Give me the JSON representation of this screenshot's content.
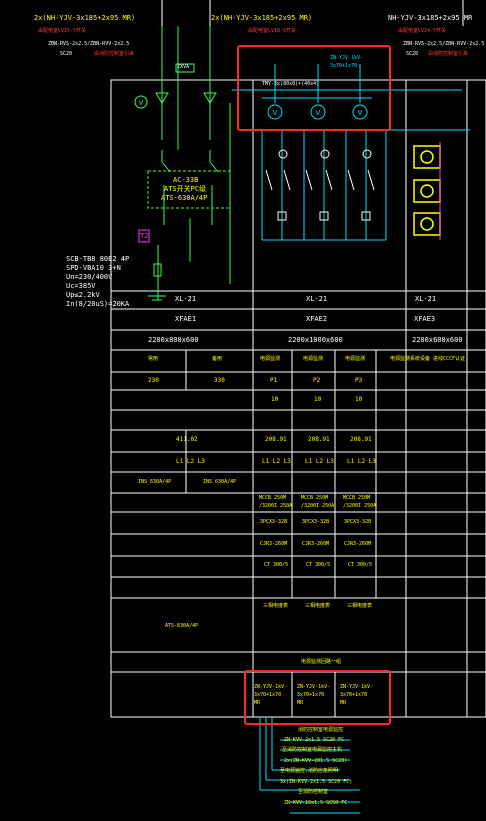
{
  "top_feeders": {
    "left_cable": "2x(NH-YJV-3x185+2x95  MR)",
    "left_source": "由配电室LVI5-5开关",
    "left_spd_cable": "ZBN-RVS-2x2.5/ZBN-RVV-2x2.5",
    "left_sc": "SC20",
    "left_fire_note": "由消防控制室引来",
    "mid_cable": "2x(NH-YJV-3x185+2x95  MR)",
    "mid_source": "由配电室LVI8-5开关",
    "right_cable": "NH-YJV-3x185+2x95  MR",
    "right_source": "由配电室LVI4-5开关",
    "right_spd_cable": "ZBN-RVS-2x2.5/ZBN-RVV-2x2.5",
    "right_sc": "SC20",
    "right_fire_note": "由消防控制室引来",
    "zxva": "ZXVA"
  },
  "measure_box": {
    "cable": "ZN-YJV-1kV-",
    "cable2": "3x70+1x70",
    "busbar": "TMY-3x(80x8)+(40x4)"
  },
  "ats": {
    "line1": "AC-33B",
    "line2": "ATS开关PC级",
    "line3": "ATS-630A/4P"
  },
  "t2_label": "T2",
  "spd_spec": [
    "SCB-TB8 80E2 4P",
    "SPD-VBA10 3+N",
    "Un=230/400V",
    "Uc=385V",
    "Up≤2.2kV",
    "In(8/20uS)=20KA"
  ],
  "header_rows": {
    "panel_numbers": [
      "XL-21",
      "XL-21",
      "XL-21"
    ],
    "panel_codes": [
      "XFAE1",
      "XFAE2",
      "XFAE3"
    ],
    "panel_dims": [
      "2200x800x600",
      "2200x1000x600",
      "2200x600x600"
    ]
  },
  "table": {
    "use_row": [
      "常用",
      "备用",
      "电源监测",
      "电源监测",
      "电源监测",
      "电源监测系统设备 进线CCCF认证"
    ],
    "row_230": [
      "230",
      "330",
      "P1",
      "P2",
      "P3"
    ],
    "row_10": [
      "10",
      "10",
      "10"
    ],
    "row_411": [
      "411.02",
      "208.91",
      "208.91",
      "208.91"
    ],
    "row_phase": [
      "L1 L2 L3",
      "L1 L2 L3",
      "L1 L2 L3",
      "L1 L2 L3"
    ],
    "row_ins": [
      "INS 630A/4P",
      "INS 630A/4P"
    ],
    "row_mccb": [
      [
        "MCCB 250M",
        "/3200I 250A"
      ],
      [
        "MCCB 250M",
        "/3200I 250A"
      ],
      [
        "MCCB 250M",
        "/3200I 250A"
      ]
    ],
    "row_3p": [
      "3PCX3-32B",
      "3PCX3-32B",
      "3PCX3-32B"
    ],
    "row_cjr": [
      "CJR3-260M",
      "CJR3-260M",
      "CJR3-260M"
    ],
    "row_ct": [
      "CT 300/5",
      "CT 300/5",
      "CT 300/5"
    ],
    "row_meter": [
      "三相电度表",
      "三相电度表",
      "三相电度表"
    ],
    "row_ats": "ATS-630A/4P",
    "row_feed_title": "电源监测回路一组",
    "feed_cables": [
      [
        "ZN-YJV-1kV-",
        "3x70+1x70",
        "MR"
      ],
      [
        "ZN-YJV-1kV-",
        "3x70+1x70",
        "MR"
      ],
      [
        "ZN-YJV-1kV-",
        "3x70+1x70",
        "MR"
      ]
    ]
  },
  "bottom_notes": [
    "消防控制室电源监控",
    "ZN-KVV-2x1.5  SC20  FC",
    "至消防控制室电源监控主机",
    "2x(ZN-KVV-2X1.5  SC20)",
    "至电源监控,消防应急照明",
    "3x(ZN-KVV-2x1.5 SC20 FC)",
    "至消防控制室",
    "ZN-KVV-16x1.5 SC50 FC"
  ],
  "colors": {
    "background": "#000000",
    "line": "#ffffff",
    "cable_text": "#ffff00",
    "source_text": "#ff3a3a",
    "circuit": "#33ff55",
    "measure": "#00e0ff",
    "control": "#ff33ff",
    "highlight": "#ff2a2a"
  }
}
